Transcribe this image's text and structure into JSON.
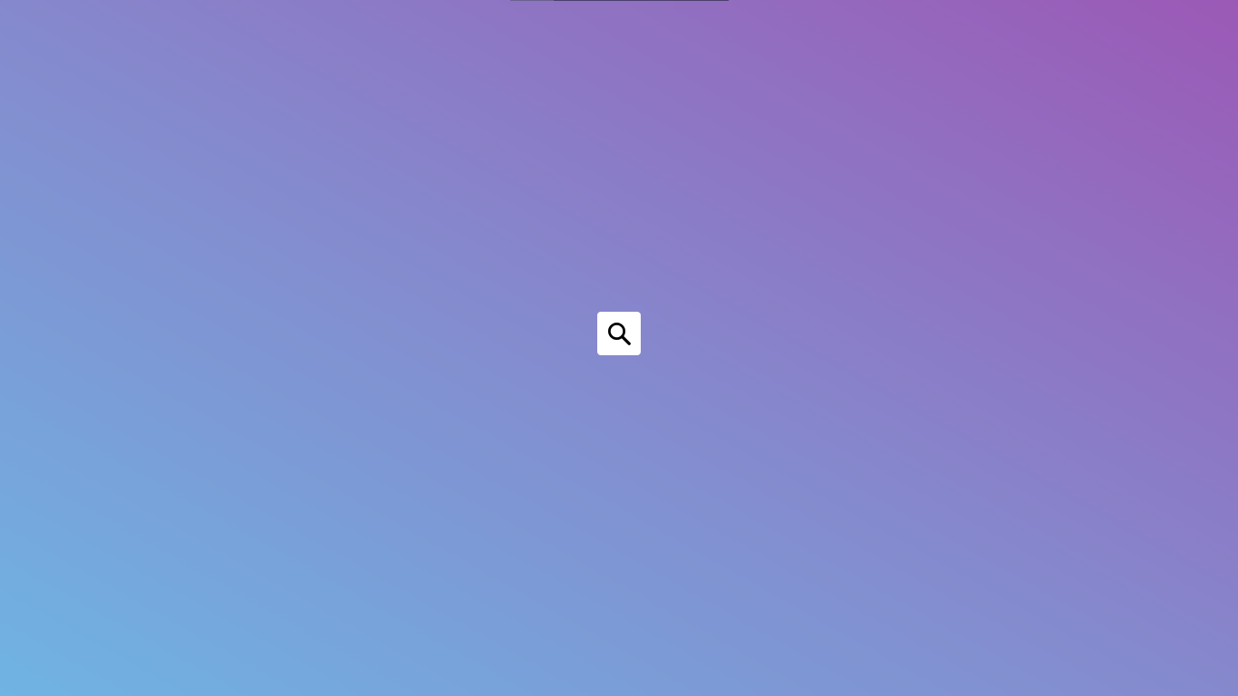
{
  "page": {
    "background_start": "#6fb4e3",
    "background_end": "#9b59b6"
  },
  "search_button": {
    "icon": "search-icon",
    "background": "#ffffff",
    "icon_color": "#000000"
  }
}
